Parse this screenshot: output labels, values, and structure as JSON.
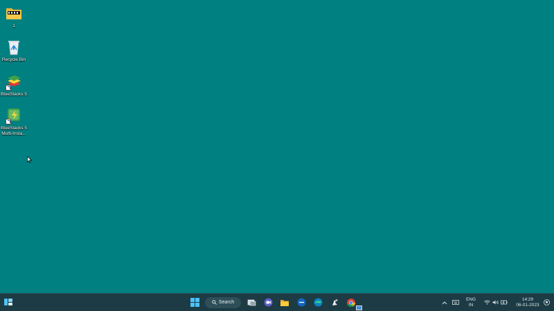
{
  "desktop": {
    "background_color": "#008080",
    "icons": [
      {
        "label": "1",
        "icon": "folder-icon"
      },
      {
        "label": "Recycle Bin",
        "icon": "recycle-bin-icon"
      },
      {
        "label": "BlueStacks 5",
        "icon": "bluestacks-icon"
      },
      {
        "label": "BlueStacks 5 Multi-Insta...",
        "icon": "bluestacks-multi-instance-icon"
      }
    ]
  },
  "taskbar": {
    "search_label": "Search",
    "apps": [
      "start-icon",
      "search-button",
      "task-view-icon",
      "teams-chat-icon",
      "file-explorer-icon",
      "app-icon",
      "edge-icon",
      "app-icon",
      "chrome-icon"
    ],
    "tray": {
      "language_line1": "ENG",
      "language_line2": "IN",
      "time": "14:29",
      "date": "06-01-2023"
    }
  }
}
